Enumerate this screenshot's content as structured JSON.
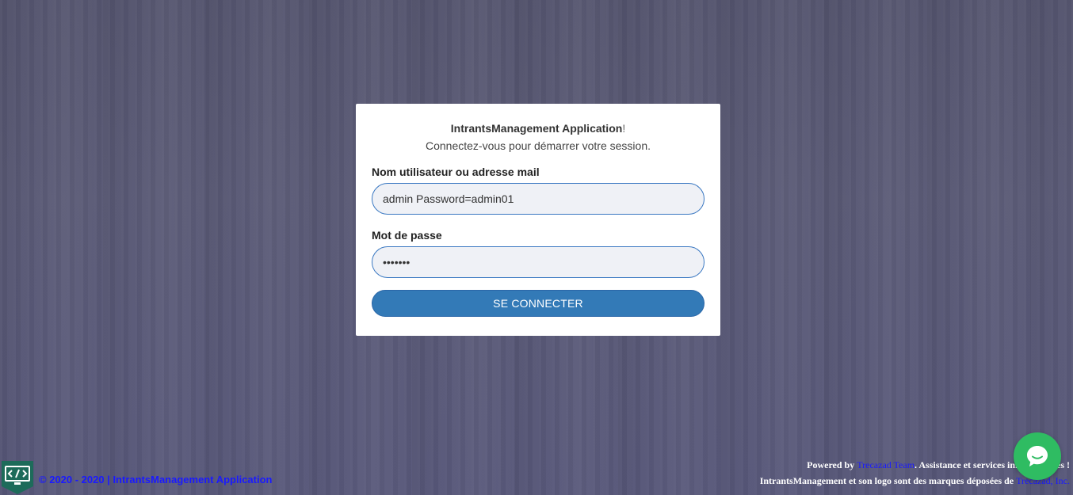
{
  "login": {
    "app_name": "IntrantsManagement Application",
    "exclaim": "!",
    "subtitle": "Connectez-vous pour démarrer votre session.",
    "username_label": "Nom utilisateur ou adresse mail",
    "username_value": "admin Password=admin01",
    "password_label": "Mot de passe",
    "password_value": "admin01",
    "submit_label": "SE CONNECTER"
  },
  "footer": {
    "copyright": "© 2020 - 2020 | IntrantsManagement Application",
    "powered_prefix": "Powered by ",
    "powered_link": "Trecazad Team",
    "powered_suffix": ". Assistance et services informatiques !",
    "trademark_prefix": "IntrantsManagement et son logo sont des marques déposées de ",
    "trademark_link": "Trecazad, Inc."
  },
  "icons": {
    "logo": "code-monitor-icon",
    "chat": "chat-bubble-icon"
  },
  "colors": {
    "background": "#58587a",
    "primary_button": "#337ab7",
    "input_border": "#3a78c2",
    "link": "#1a1aff",
    "chat": "#2fbc62"
  }
}
